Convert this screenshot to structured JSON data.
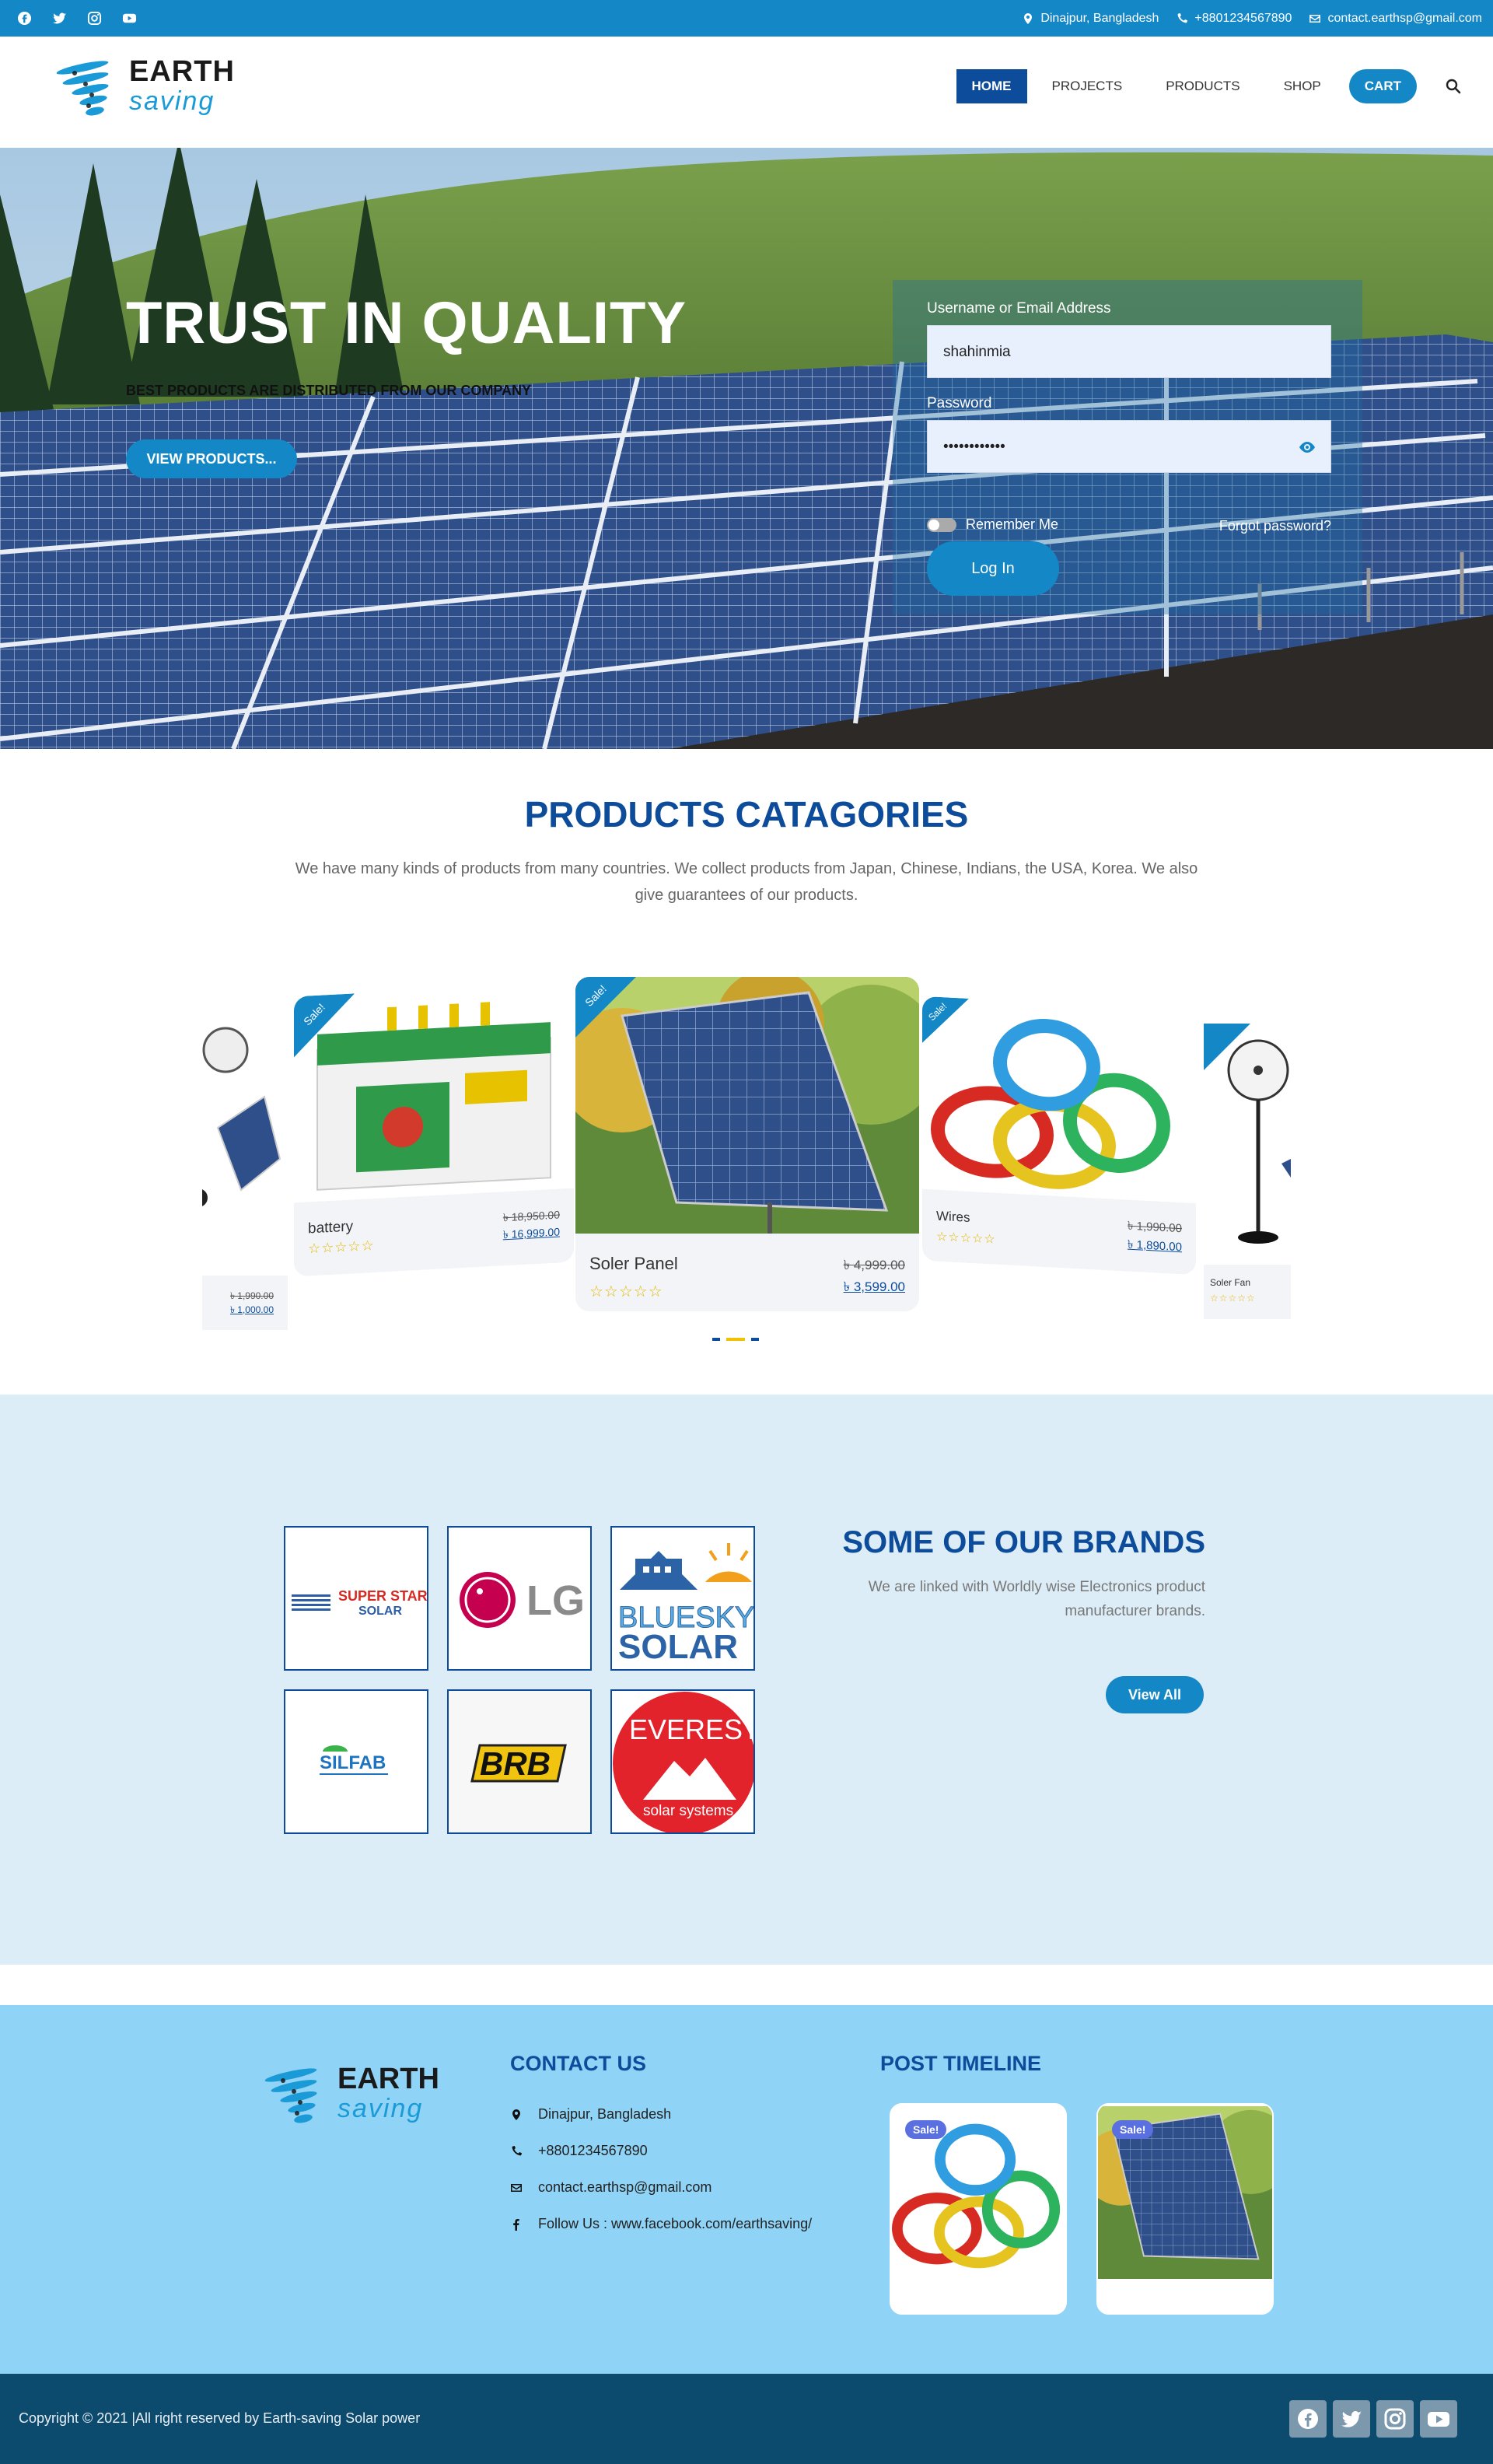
{
  "topbar": {
    "social": [
      "facebook-icon",
      "twitter-icon",
      "instagram-icon",
      "youtube-icon"
    ],
    "location": "Dinajpur, Bangladesh",
    "phone": "+8801234567890",
    "email": "contact.earthsp@gmail.com"
  },
  "header": {
    "logo_line1": "EARTH",
    "logo_line2": "saving",
    "nav": [
      "HOME",
      "PROJECTS",
      "PRODUCTS",
      "SHOP",
      "CART"
    ],
    "search_icon": "search-icon"
  },
  "hero": {
    "title": "TRUST IN QUALITY",
    "subtitle": "BEST PRODUCTS ARE DISTRIBUTED FROM OUR COMPANY",
    "button": "VIEW PRODUCTS...",
    "login": {
      "username_label": "Username or Email Address",
      "username_value": "shahinmia",
      "password_label": "Password",
      "password_value": "••••••••••••",
      "remember": "Remember Me",
      "forgot": "Forgot password?",
      "submit": "Log In"
    }
  },
  "categories": {
    "title": "PRODUCTS CATAGORIES",
    "description": "We have many kinds of products from many countries. We collect products from Japan, Chinese, Indians, the USA, Korea. We also give guarantees of our products.",
    "sale_label": "Sale!",
    "products": [
      {
        "name": "battery",
        "old_price": "৳ 18,950.00",
        "new_price": "৳ 16,999.00"
      },
      {
        "name": "Soler Panel",
        "old_price": "৳ 4,999.00",
        "new_price": "৳ 3,599.00"
      },
      {
        "name": "Wires",
        "old_price": "৳ 1,990.00",
        "new_price": "৳ 1,890.00"
      },
      {
        "name": "Soler Fan",
        "old_price": "",
        "new_price": ""
      }
    ],
    "side_left_prices": [
      "৳ 1,990.00",
      "৳ 1,000.00"
    ],
    "stars": "☆☆☆☆☆"
  },
  "brands": {
    "title": "SOME OF OUR BRANDS",
    "description": "We are linked with Worldly wise Electronics product manufacturer brands.",
    "button": "View All",
    "logos": [
      "SUPER STAR SOLAR",
      "LG",
      "BLUESKY SOLAR",
      "SILFAB",
      "BRB",
      "EVEREST solar systems"
    ]
  },
  "footer": {
    "logo_line1": "EARTH",
    "logo_line2": "saving",
    "contact_title": "CONTACT US",
    "location": "Dinajpur, Bangladesh",
    "phone": "+8801234567890",
    "email": "contact.earthsp@gmail.com",
    "facebook": "Follow Us : www.facebook.com/earthsaving/",
    "timeline_title": "POST TIMELINE",
    "sale_badge": "Sale!",
    "copyright": "Copyright © 2021 |All right reserved by Earth-saving Solar power"
  }
}
